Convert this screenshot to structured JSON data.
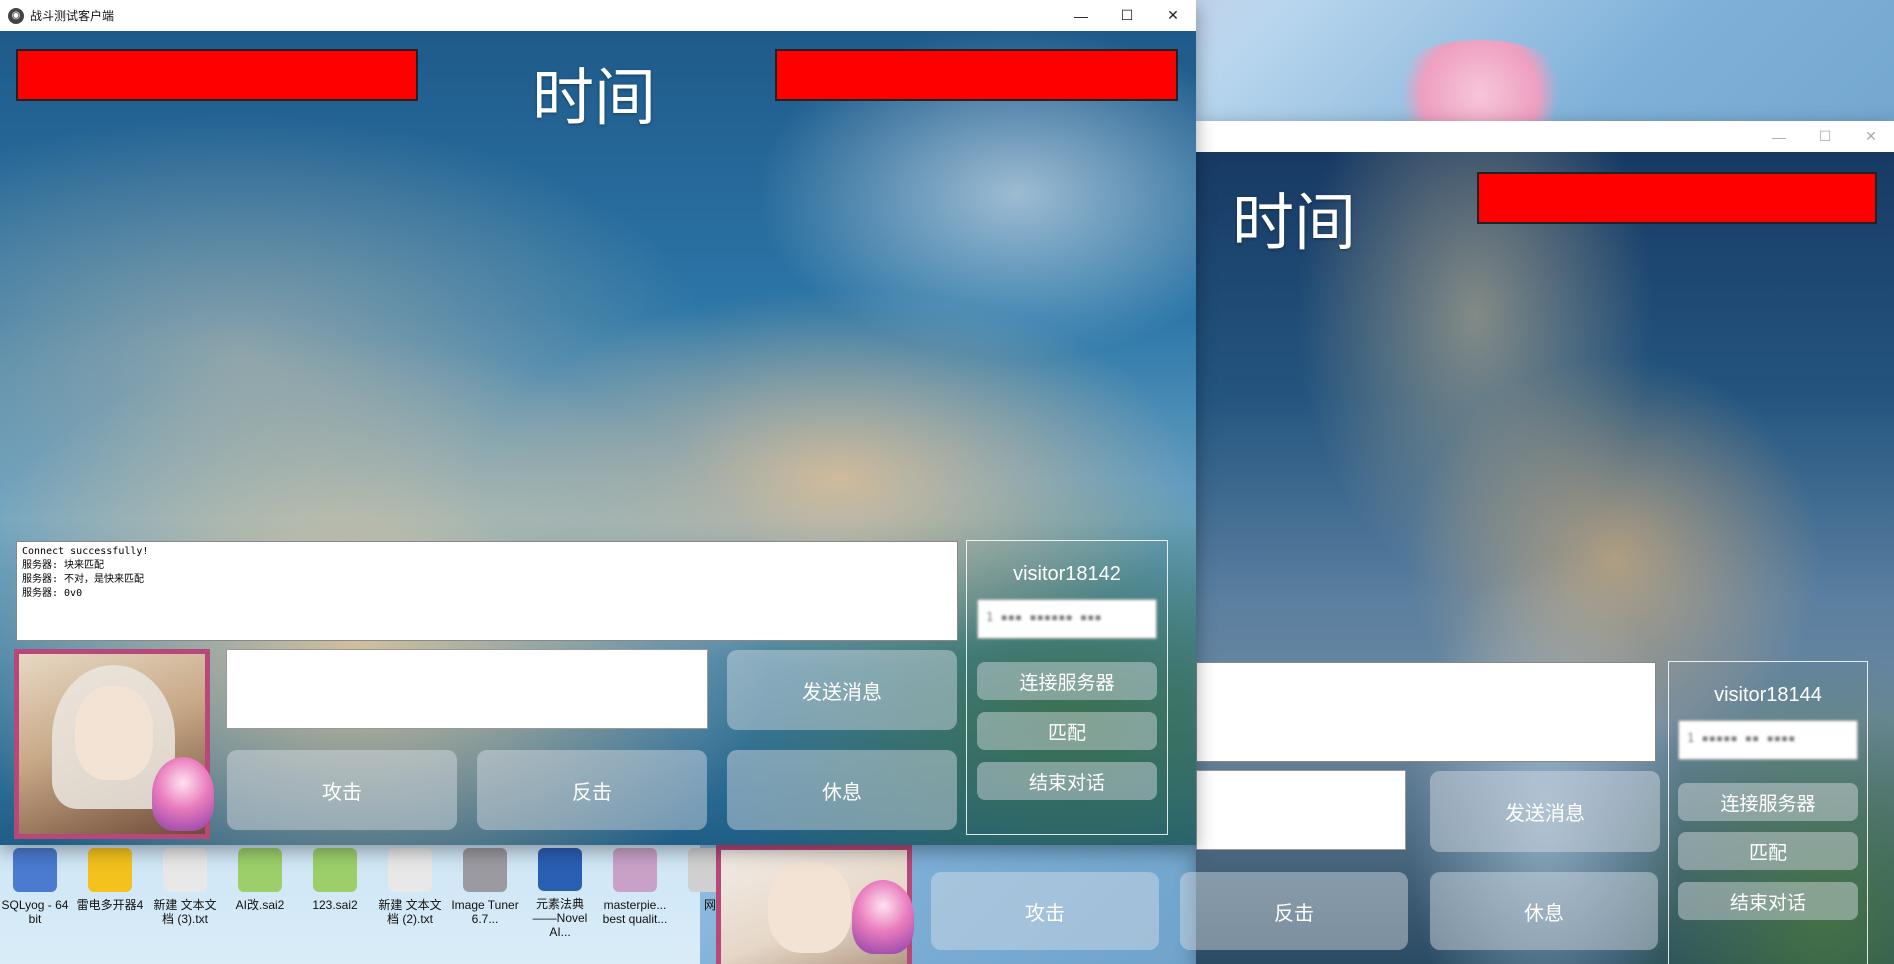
{
  "desktop": {
    "icons": [
      {
        "label": "SQLyog - 64 bit",
        "icon": "sqlyog-dolphin-icon",
        "color": "#4a7bd0"
      },
      {
        "label": "雷电多开器4",
        "icon": "ldplayer-multi-icon",
        "color": "#f4c21d"
      },
      {
        "label": "新建 文本文档 (3).txt",
        "icon": "text-file-icon",
        "color": "#e8e8e8"
      },
      {
        "label": "AI改.sai2",
        "icon": "sai2-icon",
        "color": "#9ccf6a"
      },
      {
        "label": "123.sai2",
        "icon": "sai2-icon",
        "color": "#9ccf6a"
      },
      {
        "label": "新建 文本文档 (2).txt",
        "icon": "text-file-icon",
        "color": "#e8e8e8"
      },
      {
        "label": "Image Tuner 6.7...",
        "icon": "elephant-icon",
        "color": "#9a9aa0"
      },
      {
        "label": "元素法典——Novel AI...",
        "icon": "word-doc-icon",
        "color": "#2b5fb4"
      },
      {
        "label": "masterpie... best qualit...",
        "icon": "anime-image-icon",
        "color": "#c9a1c8"
      },
      {
        "label": "网",
        "icon": "partial-icon",
        "color": "#d0d0d0"
      }
    ]
  },
  "window_main": {
    "title": "战斗测试客户端",
    "time_label": "时间",
    "log_lines": [
      "Connect successfully!",
      "服务器: 块来匹配",
      "服务器: 不对，是快来匹配",
      "服务器: 0v0"
    ],
    "buttons": {
      "send": "发送消息",
      "attack": "攻击",
      "counter": "反击",
      "rest": "休息",
      "connect": "连接服务器",
      "match": "匹配",
      "end_chat": "结束对话"
    },
    "visitor": "visitor18142",
    "ip_value": "1 ▪▪▪ ▪▪▪▪▪▪ ▪▪▪"
  },
  "window_second": {
    "time_label": "时间",
    "buttons": {
      "send": "发送消息",
      "attack": "攻击",
      "counter": "反击",
      "rest": "休息",
      "connect": "连接服务器",
      "match": "匹配",
      "end_chat": "结束对话"
    },
    "visitor": "visitor18144",
    "ip_value": "1 ▪▪▪▪▪ ▪▪ ▪▪▪▪"
  },
  "colors": {
    "hp_bar": "#ff0000",
    "avatar_frame": "#b8477a",
    "titlebar": "#ffffff"
  }
}
